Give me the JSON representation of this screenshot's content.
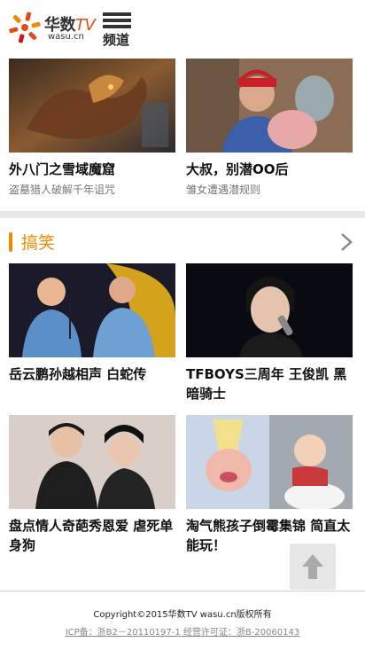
{
  "header": {
    "logo_text": "华数",
    "logo_tv": "TV",
    "logo_domain": "wasu.cn",
    "menu_label": "频道"
  },
  "top_cards": [
    {
      "title": "外八门之雪域魔窟",
      "subtitle": "盗墓猎人破解千年诅咒"
    },
    {
      "title": "大叔，别潜OO后",
      "subtitle": "雏女遭遇潜规则"
    }
  ],
  "section": {
    "title": "搞笑",
    "accent_color": "#f08a00",
    "items": [
      {
        "title": "岳云鹏孙越相声 白蛇传"
      },
      {
        "title": "TFBOYS三周年 王俊凯 黑暗骑士"
      },
      {
        "title": "盘点情人奇葩秀恩爱 虐死单身狗"
      },
      {
        "title": "淘气熊孩子倒霉集锦 简直太能玩！"
      }
    ]
  },
  "footer": {
    "copyright": "Copyright©2015华数TV wasu.cn版权所有",
    "icp": "ICP备：浙B2－20110197-1 经营许可证：浙B-20060143"
  },
  "icons": {
    "menu": "menu-icon",
    "more": "chevron-right-icon",
    "back_to_top": "arrow-up-icon"
  }
}
